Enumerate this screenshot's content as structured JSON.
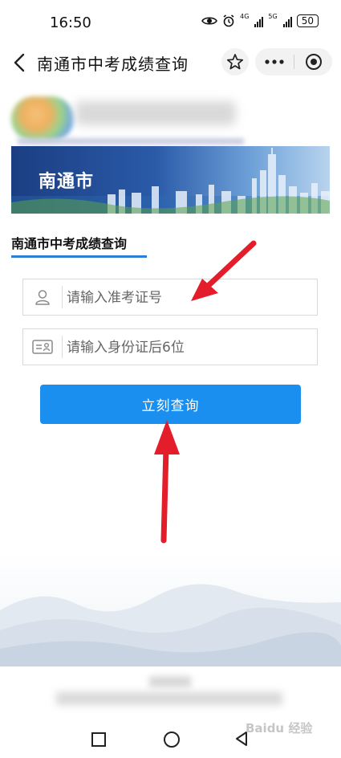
{
  "status_bar": {
    "time": "16:50",
    "net1": "4G",
    "net2": "5G",
    "battery": "50"
  },
  "nav": {
    "title": "南通市中考成绩查询",
    "icons": [
      "back-arrow-icon",
      "star-icon",
      "more-icon",
      "target-icon"
    ]
  },
  "banner": {
    "city": "南通市"
  },
  "tab": {
    "title": "南通市中考成绩查询"
  },
  "form": {
    "exam_placeholder": "请输入准考证号",
    "id_placeholder": "请输入身份证后6位",
    "submit_label": "立刻查询"
  },
  "watermark": "Baidu 经验",
  "colors": {
    "accent": "#1a8ff0",
    "tab_underline": "#2b7fd8",
    "banner": "#1b3e82",
    "arrow": "#e41d2b"
  }
}
